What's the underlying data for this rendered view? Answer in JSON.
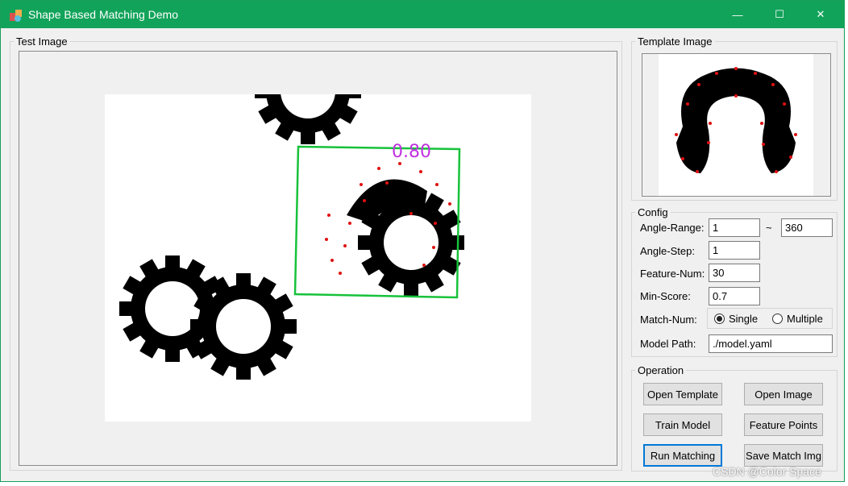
{
  "window": {
    "title": "Shape Based Matching Demo"
  },
  "controls": {
    "minimize": "—",
    "maximize": "☐",
    "close": "✕"
  },
  "test_image": {
    "label": "Test Image",
    "score": "0.80"
  },
  "template_image": {
    "label": "Template Image"
  },
  "config": {
    "label": "Config",
    "angle_range_label": "Angle-Range:",
    "angle_from": "1",
    "tilde": "~",
    "angle_to": "360",
    "angle_step_label": "Angle-Step:",
    "angle_step": "1",
    "feature_num_label": "Feature-Num:",
    "feature_num": "30",
    "min_score_label": "Min-Score:",
    "min_score": "0.7",
    "match_num_label": "Match-Num:",
    "single": "Single",
    "multiple": "Multiple",
    "model_path_label": "Model Path:",
    "model_path": "./model.yaml"
  },
  "operation": {
    "label": "Operation",
    "open_template": "Open Template",
    "open_image": "Open Image",
    "train_model": "Train Model",
    "feature_points": "Feature Points",
    "run_matching": "Run Matching",
    "save_match_img": "Save Match Img"
  },
  "watermark": "CSDN @Color Space",
  "colors": {
    "titlebar": "#12a35a",
    "match_box": "#17c23a",
    "score": "#c030e0",
    "points": "#e01010"
  }
}
